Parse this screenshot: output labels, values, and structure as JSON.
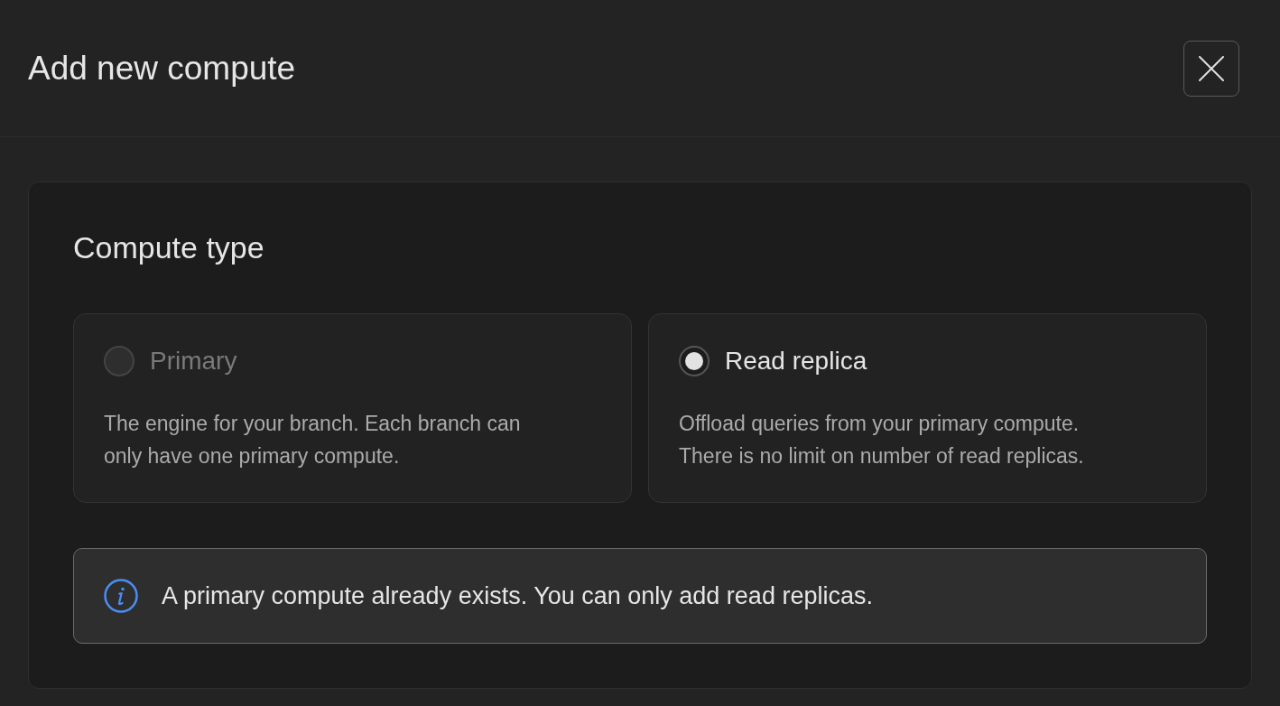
{
  "dialog": {
    "title": "Add new compute"
  },
  "compute_type": {
    "heading": "Compute type",
    "options": [
      {
        "label": "Primary",
        "description": "The engine for your branch. Each branch can only have one primary compute.",
        "selected": false,
        "disabled": true
      },
      {
        "label": "Read replica",
        "description": "Offload queries from your primary compute. There is no limit on number of read replicas.",
        "selected": true,
        "disabled": false
      }
    ],
    "notice": {
      "text": "A primary compute already exists. You can only add read replicas."
    }
  }
}
